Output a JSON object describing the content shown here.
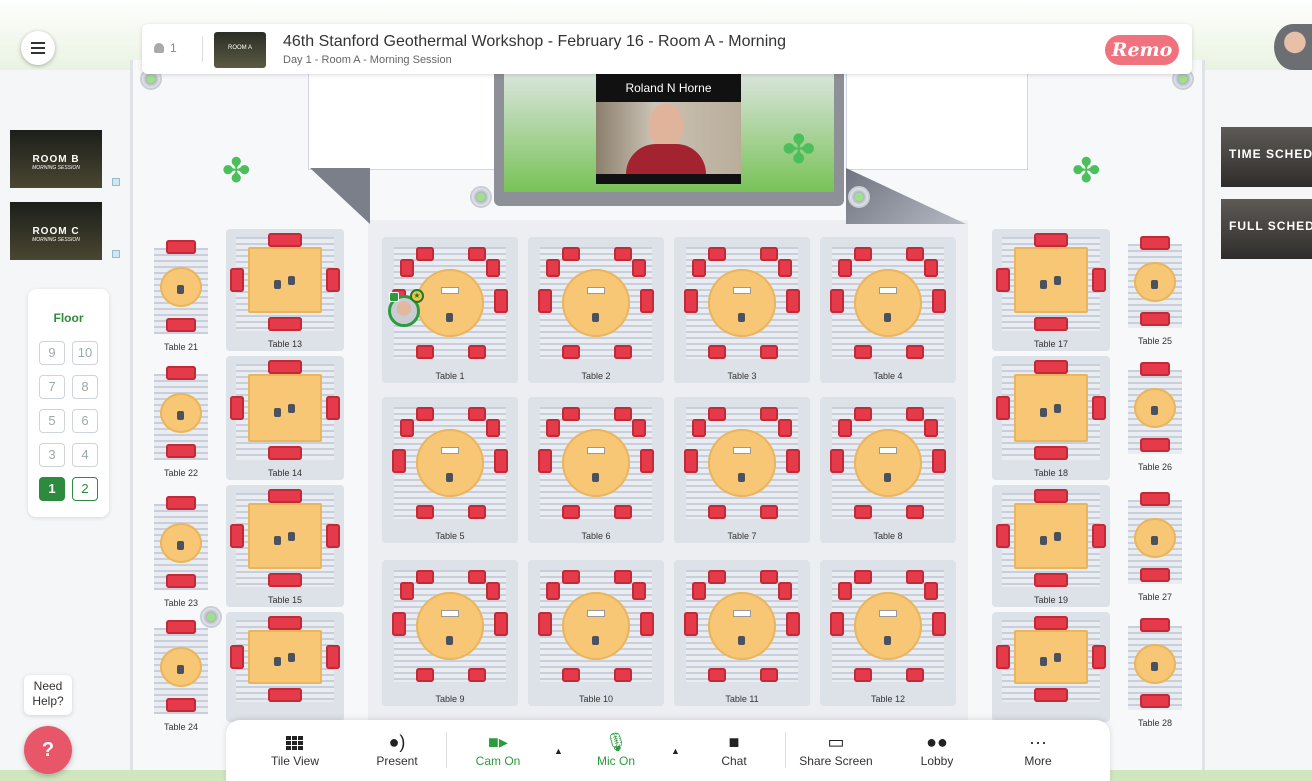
{
  "header": {
    "attendee_count": "1",
    "room_thumb_label": "ROOM A",
    "title": "46th Stanford Geothermal Workshop - February 16 - Room A - Morning",
    "subtitle": "Day 1 - Room A - Morning Session",
    "brand": "Remo"
  },
  "side_rooms": [
    {
      "label": "ROOM B",
      "sub": "MORNING SESSION"
    },
    {
      "label": "ROOM C",
      "sub": "MORNING SESSION"
    }
  ],
  "right_rooms": [
    {
      "label": "TIME SCHEDU"
    },
    {
      "label": "FULL SCHEDU"
    }
  ],
  "floor_switcher": {
    "label": "Floor",
    "floors": [
      "9",
      "10",
      "7",
      "8",
      "5",
      "6",
      "3",
      "4",
      "1",
      "2"
    ],
    "active": "1"
  },
  "stage": {
    "speaker_name": "Roland N Horne"
  },
  "tables": {
    "t1": "Table 1",
    "t2": "Table 2",
    "t3": "Table 3",
    "t4": "Table 4",
    "t5": "Table 5",
    "t6": "Table 6",
    "t7": "Table 7",
    "t8": "Table 8",
    "t9": "Table 9",
    "t10": "Table 10",
    "t11": "Table 11",
    "t12": "Table 12",
    "t13": "Table 13",
    "t14": "Table 14",
    "t15": "Table 15",
    "t17": "Table 17",
    "t18": "Table 18",
    "t19": "Table 19",
    "t21": "Table 21",
    "t22": "Table 22",
    "t23": "Table 23",
    "t24": "Table 24",
    "t25": "Table 25",
    "t26": "Table 26",
    "t27": "Table 27",
    "t28": "Table 28"
  },
  "toolbar": {
    "tile_view": "Tile View",
    "present": "Present",
    "cam": "Cam On",
    "mic": "Mic On",
    "chat": "Chat",
    "share": "Share Screen",
    "lobby": "Lobby",
    "more": "More"
  },
  "help": {
    "line1": "Need",
    "line2": "Help?"
  },
  "colors": {
    "accent_green": "#2e9a3f",
    "brand_pink": "#f0727e",
    "chair_red": "#e53a4a",
    "table_wood": "#f7c776"
  }
}
